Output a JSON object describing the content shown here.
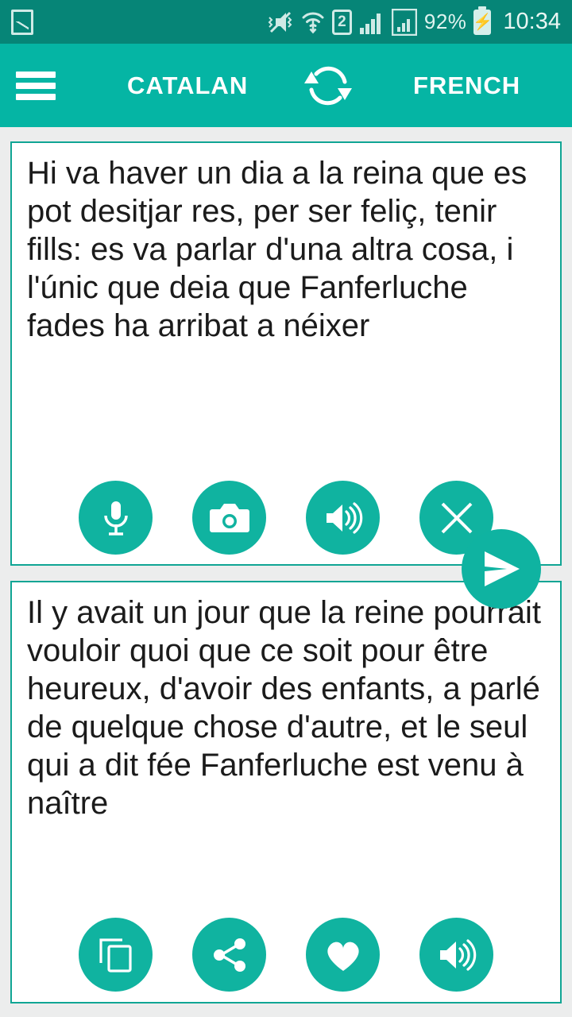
{
  "status_bar": {
    "left_icon": "gallery-icon",
    "icons": [
      "vibrate-mute-icon",
      "wifi-icon",
      "sim2-icon",
      "signal-bars-icon",
      "signal-bars-2-icon"
    ],
    "sim_label": "2",
    "battery_percent": "92%",
    "battery_state": "charging",
    "time": "10:34",
    "background_color": "#068577",
    "foreground_color": "#d9f2ee"
  },
  "header": {
    "menu_icon": "hamburger-menu-icon",
    "source_language": "CATALAN",
    "swap_icon": "swap-languages-icon",
    "target_language": "FRENCH",
    "background_color": "#05b5a4"
  },
  "source_card": {
    "text": "Hi va haver un dia a la reina que es pot desitjar res, per ser feliç, tenir fills: es va parlar d'una altra cosa, i l'únic que deia que Fanferluche fades ha arribat a néixer",
    "actions": [
      {
        "name": "microphone",
        "icon": "microphone-icon"
      },
      {
        "name": "camera",
        "icon": "camera-icon"
      },
      {
        "name": "speak",
        "icon": "speaker-icon"
      },
      {
        "name": "clear",
        "icon": "close-icon"
      }
    ]
  },
  "translate_button": {
    "icon": "send-icon",
    "label": "Translate"
  },
  "target_card": {
    "text": "Il y avait un jour que la reine pourrait vouloir quoi que ce soit pour être heureux, d'avoir des enfants, a parlé de quelque chose d'autre, et le seul qui a dit fée Fanferluche est venu à naître",
    "actions": [
      {
        "name": "copy",
        "icon": "copy-icon"
      },
      {
        "name": "share",
        "icon": "share-icon"
      },
      {
        "name": "favorite",
        "icon": "heart-icon"
      },
      {
        "name": "speak",
        "icon": "speaker-icon"
      }
    ]
  },
  "theme": {
    "accent": "#10b3a0",
    "card_border": "#10a594",
    "page_background": "#eceded",
    "text_color": "#1b1b1b"
  }
}
